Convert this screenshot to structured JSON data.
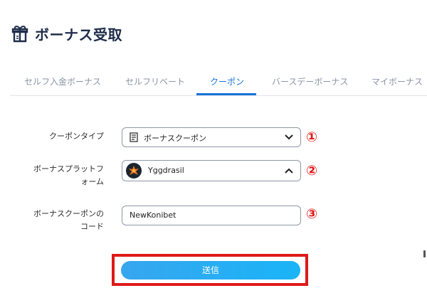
{
  "header": {
    "title": "ボーナス受取",
    "icon": "gift-icon"
  },
  "tabs": [
    {
      "label": "セルフ入金ボーナス",
      "active": false
    },
    {
      "label": "セルフリベート",
      "active": false
    },
    {
      "label": "クーポン",
      "active": true
    },
    {
      "label": "バースデーボーナス",
      "active": false
    },
    {
      "label": "マイボーナス",
      "active": false
    }
  ],
  "form": {
    "coupon_type": {
      "label": "クーポンタイプ",
      "value": "ボーナスクーポン",
      "icon": "coupon-icon",
      "marker": "①"
    },
    "platform": {
      "label_line1": "ボーナスプラットフ",
      "label_line2": "ォーム",
      "value": "Yggdrasil",
      "icon": "yggdrasil-logo-icon",
      "marker": "②"
    },
    "coupon_code": {
      "label_line1": "ボーナスクーポンの",
      "label_line2": "コード",
      "value": "NewKonibet",
      "marker": "③"
    }
  },
  "submit": {
    "label": "送信"
  },
  "colors": {
    "accent": "#1a74d8",
    "button": "#29aef4",
    "highlight": "#e01818"
  }
}
